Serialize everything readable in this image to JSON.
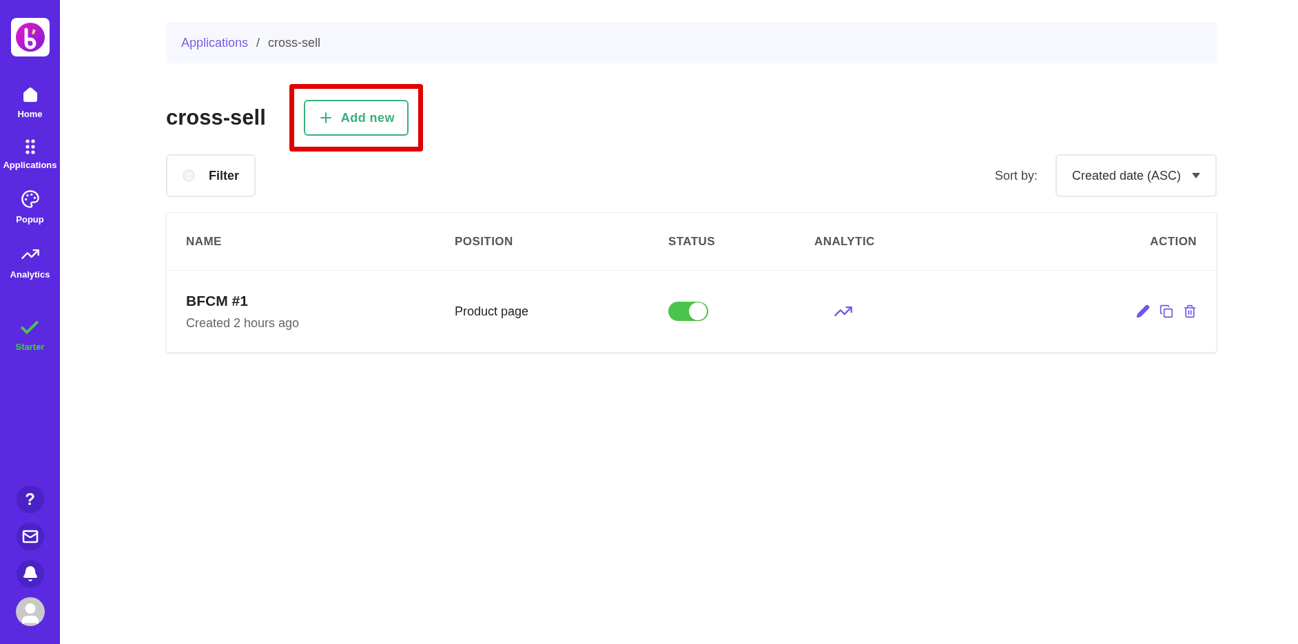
{
  "sidebar": {
    "items": [
      {
        "label": "Home",
        "kind": "home"
      },
      {
        "label": "Applications",
        "kind": "apps"
      },
      {
        "label": "Popup",
        "kind": "palette"
      },
      {
        "label": "Analytics",
        "kind": "chart"
      }
    ],
    "plan": "Starter",
    "bottom": [
      {
        "kind": "help",
        "label": "?"
      },
      {
        "kind": "mail"
      },
      {
        "kind": "bell"
      },
      {
        "kind": "avatar"
      }
    ]
  },
  "breadcrumb": [
    {
      "label": "Applications",
      "kind": "link"
    },
    {
      "label": "/",
      "kind": "text"
    },
    {
      "label": "cross-sell",
      "kind": "text"
    }
  ],
  "page_title": "cross-sell",
  "add_button": {
    "label": "Add new",
    "highlighted": true
  },
  "filter": {
    "label": "Filter",
    "checked": false
  },
  "sort": {
    "label": "Sort by:",
    "value": "Created date (ASC)"
  },
  "table": {
    "columns": [
      {
        "label": "NAME"
      },
      {
        "label": "POSITION"
      },
      {
        "label": "STATUS"
      },
      {
        "label": "ANALYTIC"
      },
      {
        "label": "ACTION"
      }
    ],
    "rows": [
      {
        "name": "BFCM #1",
        "created": "Created 2 hours ago",
        "position": "Product page",
        "on": true
      }
    ]
  }
}
